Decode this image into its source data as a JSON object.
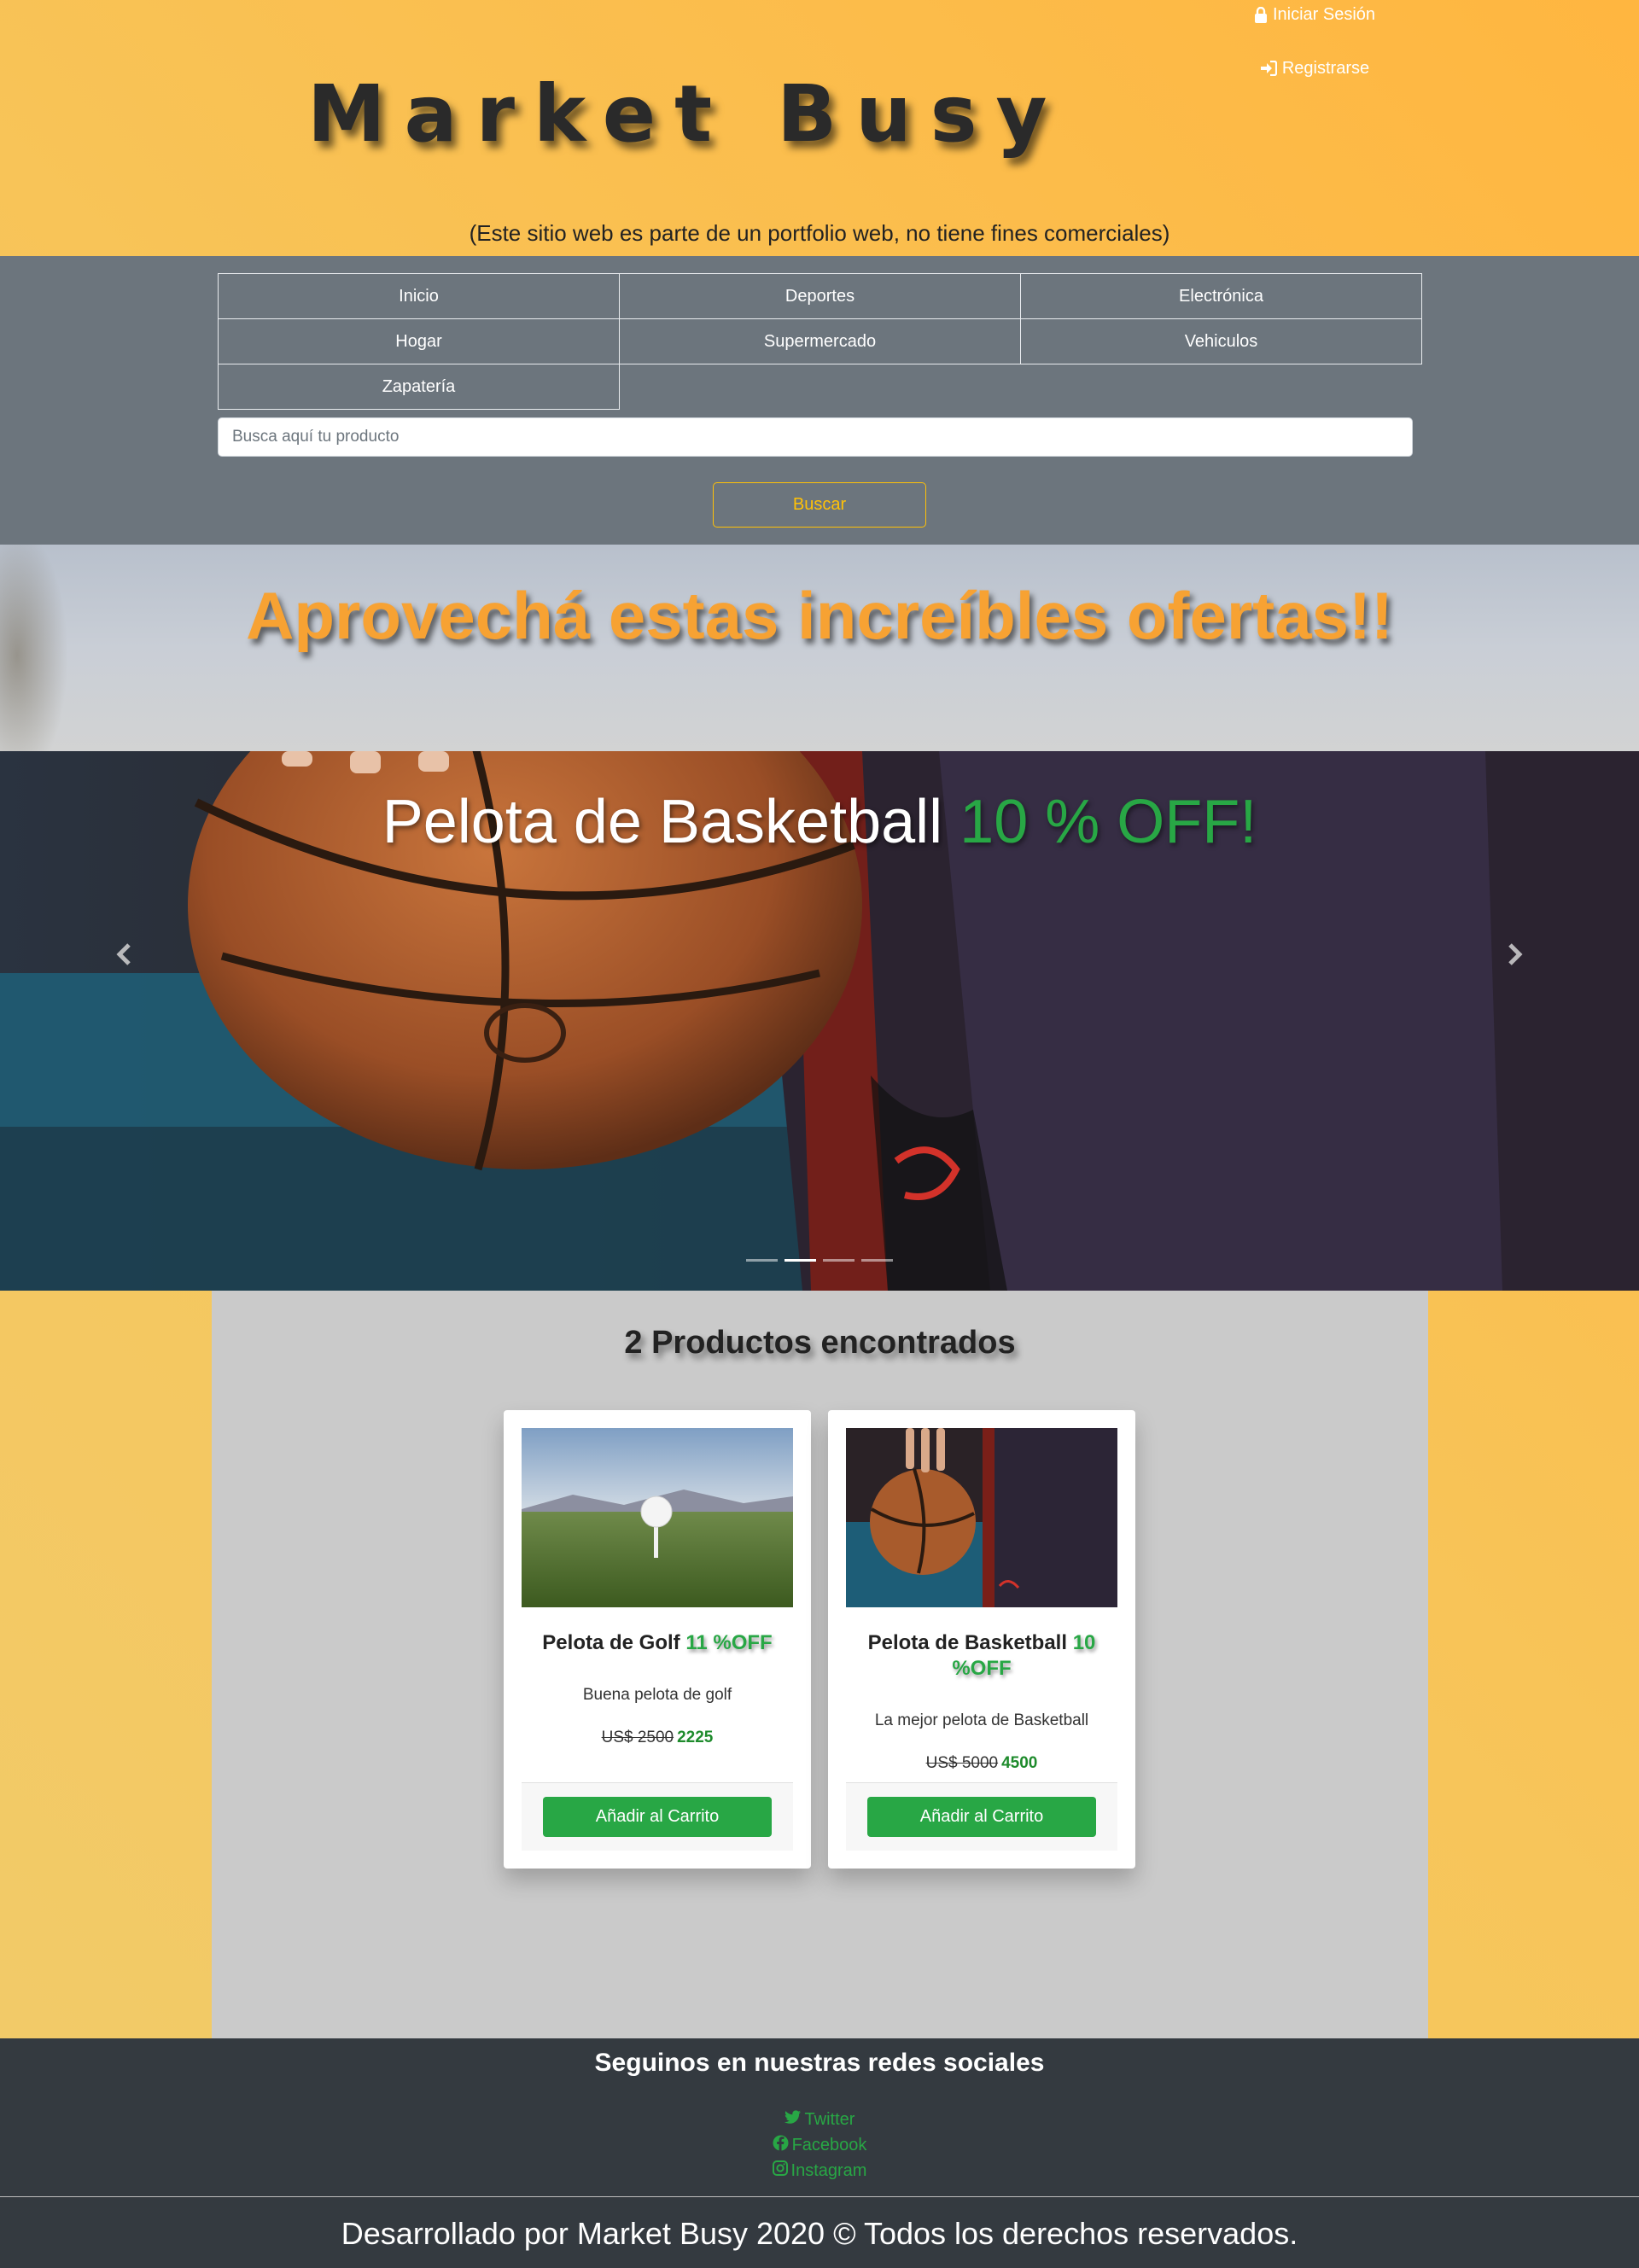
{
  "header": {
    "login_label": "Iniciar Sesión",
    "register_label": "Registrarse",
    "brand": "Market Busy",
    "disclaimer": "(Este sitio web es parte de un portfolio web, no tiene fines comerciales)"
  },
  "nav": {
    "items": [
      {
        "label": "Inicio"
      },
      {
        "label": "Deportes"
      },
      {
        "label": "Electrónica"
      },
      {
        "label": "Hogar"
      },
      {
        "label": "Supermercado"
      },
      {
        "label": "Vehiculos"
      },
      {
        "label": "Zapatería"
      }
    ]
  },
  "search": {
    "placeholder": "Busca aquí tu producto",
    "value": "",
    "button_label": "Buscar"
  },
  "promo": {
    "title": "Aprovechá estas increíbles ofertas!!"
  },
  "carousel": {
    "caption_product": "Pelota de Basketball",
    "caption_discount": "10 % OFF!",
    "indicator_count": 4,
    "active_index": 1
  },
  "results": {
    "title": "2 Productos encontrados",
    "products": [
      {
        "name": "Pelota de Golf",
        "discount": "11 %OFF",
        "description": "Buena pelota de golf",
        "old_price": "US$ 2500",
        "new_price": "2225",
        "button_label": "Añadir al Carrito"
      },
      {
        "name": "Pelota de Basketball",
        "discount": "10 %OFF",
        "description": "La mejor pelota de Basketball",
        "old_price": "US$ 5000",
        "new_price": "4500",
        "button_label": "Añadir al Carrito"
      }
    ]
  },
  "footer": {
    "social_title": "Seguinos en nuestras redes sociales",
    "social_links": [
      {
        "label": "Twitter",
        "icon": "twitter-icon"
      },
      {
        "label": "Facebook",
        "icon": "facebook-icon"
      },
      {
        "label": "Instagram",
        "icon": "instagram-icon"
      }
    ],
    "copyright": "Desarrollado por Market Busy 2020 © Todos los derechos reservados."
  },
  "colors": {
    "accent": "#ffc107",
    "success": "#28a745",
    "nav_bg": "#6c757d",
    "footer_bg": "#343a40",
    "promo_text": "#f7a233"
  }
}
